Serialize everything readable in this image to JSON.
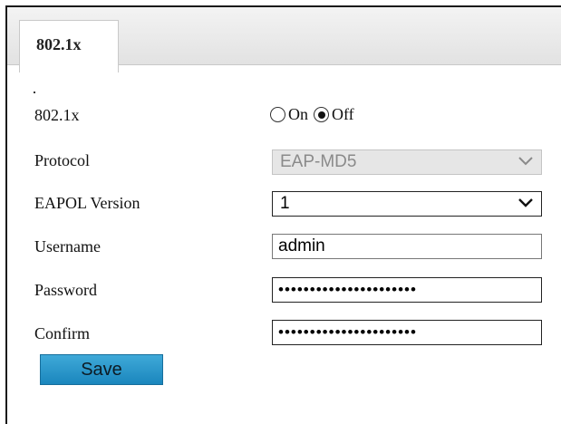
{
  "tab": {
    "label": "802.1x"
  },
  "form": {
    "mode_label": "802.1x",
    "on_label": "On",
    "off_label": "Off",
    "selected": "Off",
    "protocol_label": "Protocol",
    "protocol_value": "EAP-MD5",
    "eapol_label": "EAPOL Version",
    "eapol_value": "1",
    "username_label": "Username",
    "username_value": "admin",
    "password_label": "Password",
    "password_value": "••••••••••••••••••••••",
    "confirm_label": "Confirm",
    "confirm_value": "••••••••••••••••••••••",
    "save_label": "Save"
  },
  "colors": {
    "accent": "#2a9bd0",
    "disabled_bg": "#e6e6e6"
  }
}
